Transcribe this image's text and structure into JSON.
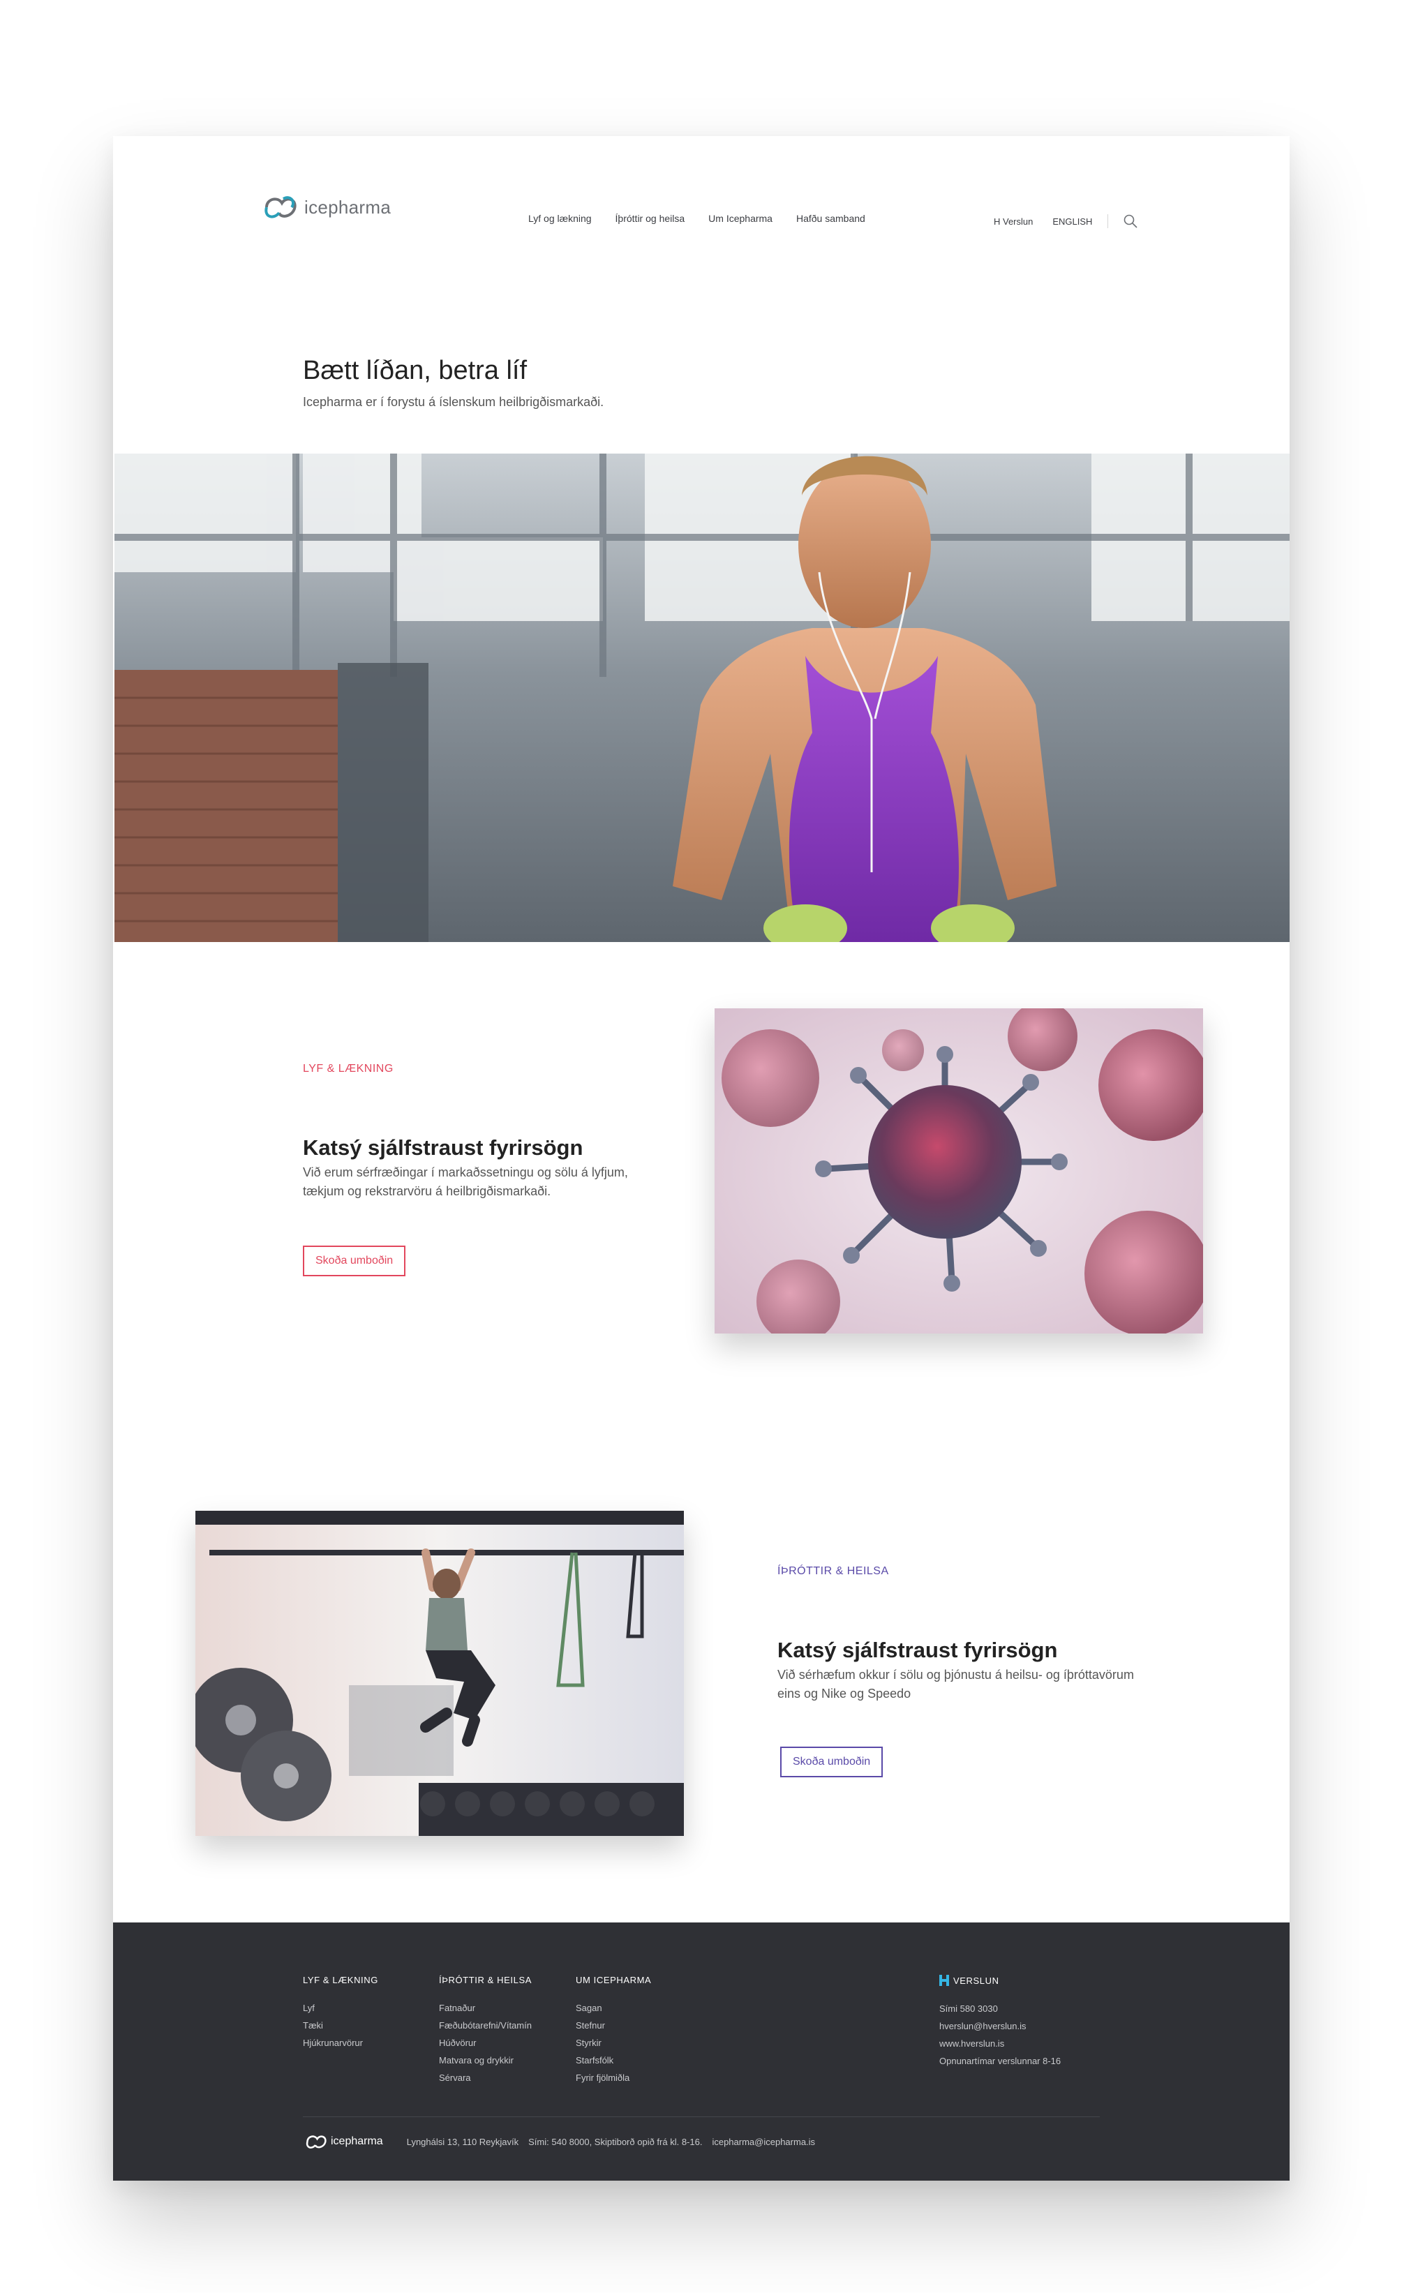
{
  "header": {
    "logo_text": "icepharma",
    "nav": [
      "Lyf og lækning",
      "Íþróttir og heilsa",
      "Um Icepharma",
      "Hafðu samband"
    ],
    "nav_right": [
      "H Verslun",
      "ENGLISH"
    ]
  },
  "intro": {
    "title": "Bætt líðan, betra líf",
    "subtitle": "Icepharma er í forystu á íslenskum heilbrigðismarkaði."
  },
  "feature1": {
    "category": "LYF & LÆKNING",
    "title": "Katsý sjálfstraust fyrirsögn",
    "text": "Við erum sérfræðingar í markaðssetningu og sölu á lyfjum, tækjum og rekstrarvöru á heilbrigðismarkaði.",
    "button": "Skoða umboðin"
  },
  "feature2": {
    "category": "ÍÞRÓTTIR & HEILSA",
    "title": "Katsý sjálfstraust fyrirsögn",
    "text": "Við sérhæfum okkur í sölu og þjónustu á heilsu- og íþróttavörum eins og Nike og Speedo",
    "button": "Skoða umboðin"
  },
  "footer": {
    "columns": [
      {
        "heading": "LYF & LÆKNING",
        "items": [
          "Lyf",
          "Tæki",
          "Hjúkrunarvörur"
        ]
      },
      {
        "heading": "ÍÞRÓTTIR & HEILSA",
        "items": [
          "Fatnaður",
          "Fæðubótarefni/Vítamín",
          "Húðvörur",
          "Matvara og drykkir",
          "Sérvara"
        ]
      },
      {
        "heading": "UM ICEPHARMA",
        "items": [
          "Sagan",
          "Stefnur",
          "Styrkir",
          "Starfsfólk",
          "Fyrir fjölmiðla"
        ]
      }
    ],
    "verslun": {
      "heading": "VERSLUN",
      "items": [
        "Sími 580 3030",
        "hverslun@hverslun.is",
        "www.hverslun.is",
        "Opnunartímar verslunnar 8-16"
      ]
    },
    "bottom": {
      "logo_text": "icepharma",
      "address": "Lynghálsi 13, 110 Reykjavík",
      "phone": "Sími: 540 8000, Skiptiborð opið frá kl. 8-16.",
      "email": "icepharma@icepharma.is"
    }
  },
  "colors": {
    "accent_red": "#e2475d",
    "accent_purple": "#5a4aa8",
    "footer_bg": "#2f3035",
    "brand_teal": "#2a9fb8"
  }
}
